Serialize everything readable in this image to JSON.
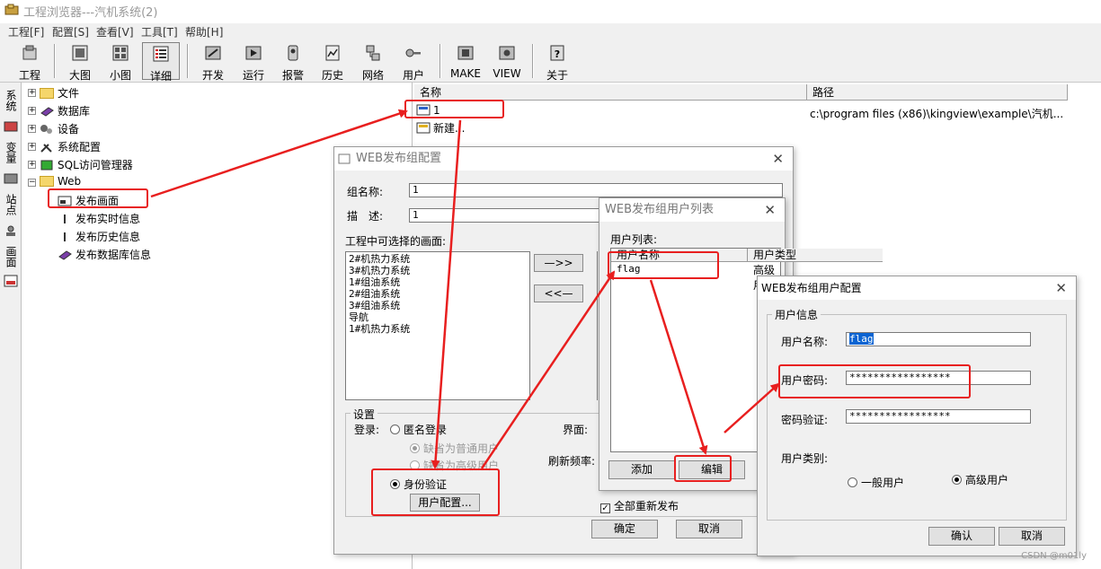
{
  "window": {
    "title": "工程浏览器---汽机系统(2)"
  },
  "menu": [
    "工程[F]",
    "配置[S]",
    "查看[V]",
    "工具[T]",
    "帮助[H]"
  ],
  "toolbar": {
    "items": [
      {
        "label": "工程",
        "icon": "project-icon"
      },
      {
        "label": "大图",
        "icon": "large-icon"
      },
      {
        "label": "小图",
        "icon": "small-icon"
      },
      {
        "label": "详细",
        "icon": "detail-icon"
      },
      {
        "label": "开发",
        "icon": "develop-icon"
      },
      {
        "label": "运行",
        "icon": "run-icon"
      },
      {
        "label": "报警",
        "icon": "alarm-icon"
      },
      {
        "label": "历史",
        "icon": "history-icon"
      },
      {
        "label": "网络",
        "icon": "network-icon"
      },
      {
        "label": "用户",
        "icon": "user-icon"
      },
      {
        "label": "MAKE",
        "icon": "make-icon"
      },
      {
        "label": "VIEW",
        "icon": "view-icon"
      },
      {
        "label": "关于",
        "icon": "about-icon"
      }
    ]
  },
  "side_tabs": [
    "系统",
    "变量",
    "站点",
    "画面"
  ],
  "tree": {
    "items": [
      "文件",
      "数据库",
      "设备",
      "系统配置",
      "SQL访问管理器",
      "Web"
    ],
    "web_children": [
      "发布画面",
      "发布实时信息",
      "发布历史信息",
      "发布数据库信息"
    ]
  },
  "list": {
    "columns": [
      "名称",
      "路径"
    ],
    "rows": [
      {
        "name": "1",
        "path": "c:\\program files (x86)\\kingview\\example\\汽机..."
      },
      {
        "name": "新建...",
        "path": ""
      }
    ]
  },
  "web_group_dialog": {
    "title": "WEB发布组配置",
    "group_name_label": "组名称:",
    "group_name_value": "1",
    "desc_label": "描　述:",
    "desc_value": "1",
    "available_label": "工程中可选择的画面:",
    "available_screens": [
      "2#机热力系统",
      "3#机热力系统",
      "1#组油系统",
      "2#组油系统",
      "3#组油系统",
      "导航",
      "1#机热力系统"
    ],
    "add_arrow": "—>>",
    "remove_arrow": "<<—",
    "settings_label": "设置",
    "login_label": "登录:",
    "anonymous_label": "匿名登录",
    "default_normal_label": "缺省为普通用户",
    "default_advanced_label": "缺省为高级用户",
    "auth_label": "身份验证",
    "user_config_button": "用户配置...",
    "interface_label": "界面:",
    "refresh_label": "刷新频率:",
    "republish_label": "全部重新发布",
    "ok_button": "确定",
    "cancel_button": "取消"
  },
  "user_list_dialog": {
    "title": "WEB发布组用户列表",
    "list_label": "用户列表:",
    "columns": [
      "用户名称",
      "用户类型"
    ],
    "rows": [
      {
        "name": "flag",
        "type": "高级用户"
      }
    ],
    "add_button": "添加",
    "edit_button": "编辑"
  },
  "user_config_dialog": {
    "title": "WEB发布组用户配置",
    "group_label": "用户信息",
    "username_label": "用户名称:",
    "username_value": "flag",
    "password_label": "用户密码:",
    "password_value": "*****************",
    "confirm_label": "密码验证:",
    "confirm_value": "*****************",
    "type_label": "用户类别:",
    "normal_user": "一般用户",
    "advanced_user": "高级用户",
    "ok_button": "确认",
    "cancel_button": "取消"
  },
  "watermark": "CSDN @m01ly",
  "colors": {
    "highlight": "#e81f1f",
    "selection": "#0a64d2"
  }
}
